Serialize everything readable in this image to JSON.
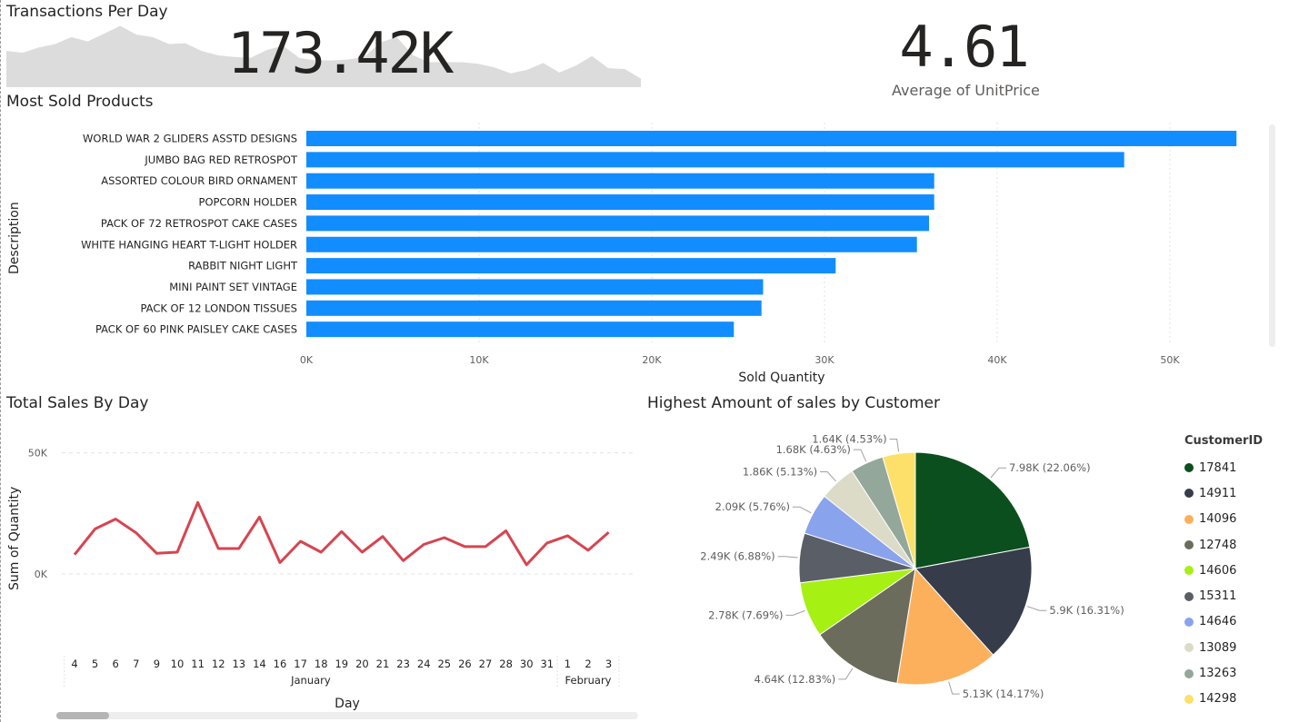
{
  "transactions": {
    "title": "Transactions Per Day",
    "value": "173.42K"
  },
  "unitprice": {
    "value": "4.61",
    "label": "Average of UnitPrice"
  },
  "colors": {
    "bar": "#118dff",
    "line": "#d64550",
    "area": "#dcdcdc",
    "grid": "#e3e3e3",
    "text": "#252423",
    "muted": "#605e5c"
  },
  "chart_data": [
    {
      "id": "transactions_sparkline",
      "type": "area",
      "values": [
        42,
        40,
        46,
        50,
        58,
        53,
        62,
        71,
        61,
        58,
        50,
        51,
        42,
        37,
        35,
        34,
        43,
        48,
        34,
        31,
        31,
        32,
        35,
        52,
        58,
        37,
        29,
        29,
        29,
        27,
        23,
        16,
        20,
        28,
        17,
        25,
        36,
        22,
        21,
        10
      ],
      "ylim": [
        0,
        80
      ]
    },
    {
      "id": "most_sold_products",
      "type": "bar",
      "orientation": "horizontal",
      "title": "Most Sold Products",
      "xlabel": "Sold Quantity",
      "ylabel": "Description",
      "categories": [
        "WORLD WAR 2 GLIDERS ASSTD DESIGNS",
        "JUMBO BAG RED RETROSPOT",
        "ASSORTED COLOUR BIRD ORNAMENT",
        "POPCORN HOLDER",
        "PACK OF 72 RETROSPOT CAKE CASES",
        "WHITE HANGING HEART T-LIGHT HOLDER",
        "RABBIT NIGHT LIGHT",
        "MINI PAINT SET VINTAGE",
        "PACK OF 12 LONDON TISSUES",
        "PACK OF 60 PINK PAISLEY CAKE CASES"
      ],
      "values": [
        53850,
        47350,
        36350,
        36350,
        36050,
        35350,
        30650,
        26450,
        26350,
        24750
      ],
      "xticks": [
        {
          "value": 0,
          "label": "0K"
        },
        {
          "value": 10000,
          "label": "10K"
        },
        {
          "value": 20000,
          "label": "20K"
        },
        {
          "value": 30000,
          "label": "30K"
        },
        {
          "value": 40000,
          "label": "40K"
        },
        {
          "value": 50000,
          "label": "50K"
        }
      ],
      "xlim": [
        0,
        54000
      ],
      "grid": true
    },
    {
      "id": "total_sales_by_day",
      "type": "line",
      "title": "Total Sales By Day",
      "xlabel": "Day",
      "ylabel": "Sum of Quantity",
      "x": [
        "4",
        "5",
        "6",
        "7",
        "9",
        "10",
        "11",
        "12",
        "13",
        "14",
        "16",
        "17",
        "18",
        "19",
        "20",
        "21",
        "23",
        "24",
        "25",
        "26",
        "27",
        "28",
        "30",
        "31",
        "1",
        "2",
        "3"
      ],
      "months": [
        {
          "label": "January",
          "from": 0,
          "to": 23
        },
        {
          "label": "February",
          "from": 24,
          "to": 26
        }
      ],
      "values": [
        8000,
        18600,
        22700,
        17000,
        8500,
        9000,
        29500,
        10500,
        10500,
        23500,
        4700,
        13500,
        9000,
        17500,
        9000,
        15500,
        5500,
        12200,
        15000,
        11300,
        11300,
        17800,
        3800,
        12800,
        15800,
        9800,
        17200
      ],
      "yticks": [
        {
          "value": 0,
          "label": "0K"
        },
        {
          "value": 50000,
          "label": "50K"
        }
      ],
      "ylim": [
        -30000,
        57000
      ],
      "grid": true
    },
    {
      "id": "sales_by_customer",
      "type": "pie",
      "title": "Highest Amount of sales by Customer",
      "legend_title": "CustomerID",
      "legend_position": "right",
      "slices": [
        {
          "name": "17841",
          "value": 7980,
          "label": "7.98K (22.06%)",
          "color": "#0a4f1d"
        },
        {
          "name": "14911",
          "value": 5900,
          "label": "5.9K (16.31%)",
          "color": "#373c4a"
        },
        {
          "name": "14096",
          "value": 5130,
          "label": "5.13K (14.17%)",
          "color": "#fdb05c"
        },
        {
          "name": "12748",
          "value": 4640,
          "label": "4.64K (12.83%)",
          "color": "#6b6c5c"
        },
        {
          "name": "14606",
          "value": 2780,
          "label": "2.78K (7.69%)",
          "color": "#a6f014"
        },
        {
          "name": "15311",
          "value": 2490,
          "label": "2.49K (6.88%)",
          "color": "#5a5e66"
        },
        {
          "name": "14646",
          "value": 2090,
          "label": "2.09K (5.76%)",
          "color": "#89a3ec"
        },
        {
          "name": "13089",
          "value": 1860,
          "label": "1.86K (5.13%)",
          "color": "#dcdbc8"
        },
        {
          "name": "13263",
          "value": 1680,
          "label": "1.68K (4.63%)",
          "color": "#94a79b"
        },
        {
          "name": "14298",
          "value": 1640,
          "label": "1.64K (4.53%)",
          "color": "#fde06a"
        }
      ]
    }
  ]
}
